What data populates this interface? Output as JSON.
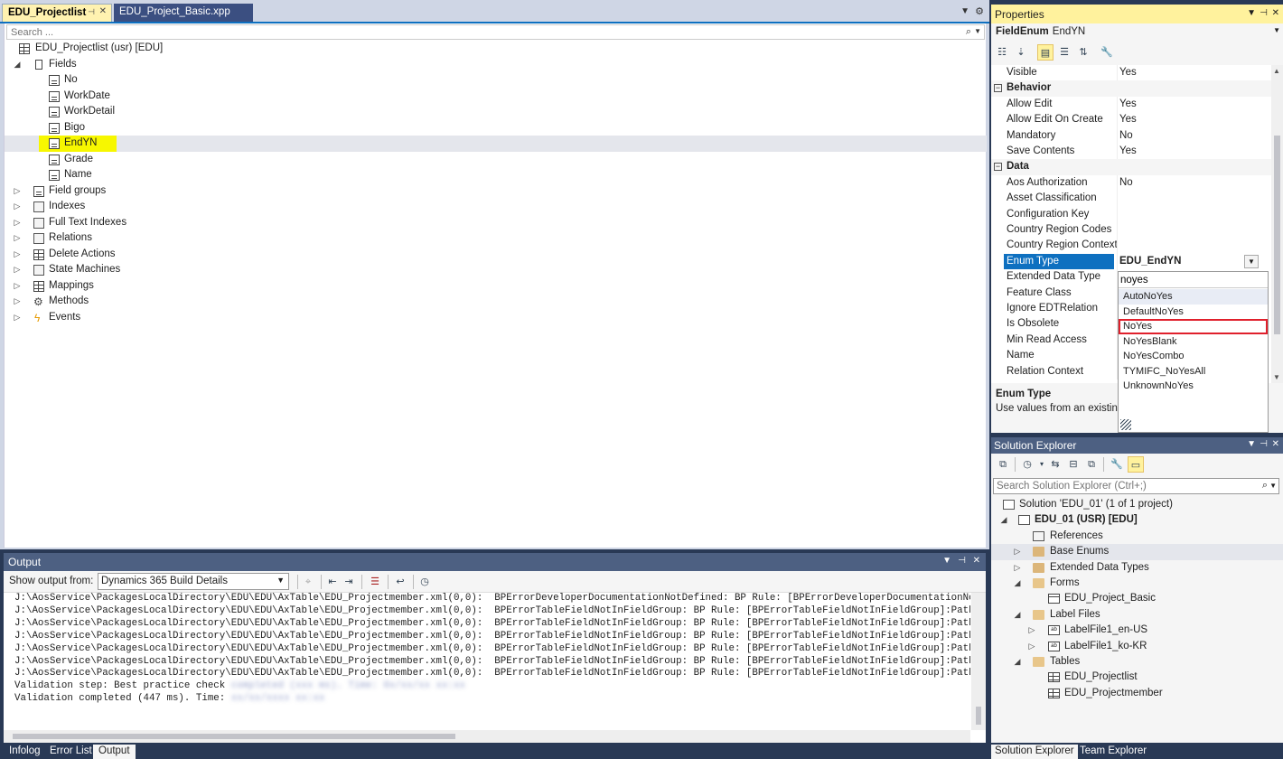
{
  "doc_tabs": {
    "active": "EDU_Projectlist",
    "inactive": "EDU_Project_Basic.xpp",
    "pin_icon": "pin-icon",
    "close_icon": "close-icon"
  },
  "designer": {
    "search_placeholder": "Search ...",
    "root": "EDU_Projectlist (usr) [EDU]",
    "fields_label": "Fields",
    "fields": [
      "No",
      "WorkDate",
      "WorkDetail",
      "Bigo",
      "EndYN",
      "Grade",
      "Name"
    ],
    "selected_field": "EndYN",
    "highlight_color": "#f7f700",
    "nodes": [
      "Field groups",
      "Indexes",
      "Full Text Indexes",
      "Relations",
      "Delete Actions",
      "State Machines",
      "Mappings",
      "Methods",
      "Events"
    ]
  },
  "output": {
    "title": "Output",
    "show_from_label": "Show output from:",
    "source": "Dynamics 365 Build Details",
    "lines": [
      "J:\\AosService\\PackagesLocalDirectory\\EDU\\EDU\\AxTable\\EDU_Projectmember.xml(0,0):  BPErrorDeveloperDocumentationNotDefined: BP Rule: [BPErrorDeveloperDocumentationNot",
      "J:\\AosService\\PackagesLocalDirectory\\EDU\\EDU\\AxTable\\EDU_Projectmember.xml(0,0):  BPErrorTableFieldNotInFieldGroup: BP Rule: [BPErrorTableFieldNotInFieldGroup]:Path",
      "J:\\AosService\\PackagesLocalDirectory\\EDU\\EDU\\AxTable\\EDU_Projectmember.xml(0,0):  BPErrorTableFieldNotInFieldGroup: BP Rule: [BPErrorTableFieldNotInFieldGroup]:Path",
      "J:\\AosService\\PackagesLocalDirectory\\EDU\\EDU\\AxTable\\EDU_Projectmember.xml(0,0):  BPErrorTableFieldNotInFieldGroup: BP Rule: [BPErrorTableFieldNotInFieldGroup]:Path",
      "J:\\AosService\\PackagesLocalDirectory\\EDU\\EDU\\AxTable\\EDU_Projectmember.xml(0,0):  BPErrorTableFieldNotInFieldGroup: BP Rule: [BPErrorTableFieldNotInFieldGroup]:Path",
      "J:\\AosService\\PackagesLocalDirectory\\EDU\\EDU\\AxTable\\EDU_Projectmember.xml(0,0):  BPErrorTableFieldNotInFieldGroup: BP Rule: [BPErrorTableFieldNotInFieldGroup]:Path",
      "J:\\AosService\\PackagesLocalDirectory\\EDU\\EDU\\AxTable\\EDU_Projectmember.xml(0,0):  BPErrorTableFieldNotInFieldGroup: BP Rule: [BPErrorTableFieldNotInFieldGroup]:Path"
    ],
    "step_line": "Validation step: Best practice check",
    "completed_line": "Validation completed (447 ms). Time:"
  },
  "bottom_tabs": [
    "Infolog",
    "Error List",
    "Output"
  ],
  "bottom_active": "Output",
  "properties": {
    "title": "Properties",
    "object_kind": "FieldEnum",
    "object_name": "EndYN",
    "rows": [
      {
        "kind": "prop",
        "name": "Visible",
        "value": "Yes"
      },
      {
        "kind": "cat",
        "name": "Behavior"
      },
      {
        "kind": "prop",
        "name": "Allow Edit",
        "value": "Yes"
      },
      {
        "kind": "prop",
        "name": "Allow Edit On Create",
        "value": "Yes"
      },
      {
        "kind": "prop",
        "name": "Mandatory",
        "value": "No"
      },
      {
        "kind": "prop",
        "name": "Save Contents",
        "value": "Yes"
      },
      {
        "kind": "cat",
        "name": "Data"
      },
      {
        "kind": "prop",
        "name": "Aos Authorization",
        "value": "No"
      },
      {
        "kind": "prop",
        "name": "Asset Classification",
        "value": ""
      },
      {
        "kind": "prop",
        "name": "Configuration Key",
        "value": ""
      },
      {
        "kind": "prop",
        "name": "Country Region Codes",
        "value": ""
      },
      {
        "kind": "prop",
        "name": "Country Region Context",
        "value": ""
      },
      {
        "kind": "sel",
        "name": "Enum Type",
        "value": "EDU_EndYN"
      },
      {
        "kind": "prop",
        "name": "Extended Data Type",
        "value": ""
      },
      {
        "kind": "prop",
        "name": "Feature Class",
        "value": ""
      },
      {
        "kind": "prop",
        "name": "Ignore EDTRelation",
        "value": ""
      },
      {
        "kind": "prop",
        "name": "Is Obsolete",
        "value": ""
      },
      {
        "kind": "prop",
        "name": "Min Read Access",
        "value": ""
      },
      {
        "kind": "prop",
        "name": "Name",
        "value": ""
      },
      {
        "kind": "prop",
        "name": "Relation Context",
        "value": ""
      }
    ],
    "desc_title": "Enum Type",
    "desc_text": "Use values from an existing",
    "selected_color": "#0e70c0"
  },
  "enum_dropdown": {
    "filter_value": "noyes",
    "options": [
      "AutoNoYes",
      "DefaultNoYes",
      "NoYes",
      "NoYesBlank",
      "NoYesCombo",
      "TYMIFC_NoYesAll",
      "UnknownNoYes"
    ],
    "boxed_option": "NoYes",
    "box_color": "#e0202c"
  },
  "solution_explorer": {
    "title": "Solution Explorer",
    "search_placeholder": "Search Solution Explorer (Ctrl+;)",
    "solution": "Solution 'EDU_01' (1 of 1 project)",
    "project": "EDU_01 (USR) [EDU]",
    "items": {
      "references": "References",
      "base_enums": "Base Enums",
      "edts": "Extended Data Types",
      "forms": "Forms",
      "form_basic": "EDU_Project_Basic",
      "label_files": "Label Files",
      "label_en": "LabelFile1_en-US",
      "label_ko": "LabelFile1_ko-KR",
      "tables": "Tables",
      "table_list": "EDU_Projectlist",
      "table_member": "EDU_Projectmember"
    }
  },
  "side_tabs": [
    "Solution Explorer",
    "Team Explorer"
  ],
  "side_active": "Solution Explorer"
}
